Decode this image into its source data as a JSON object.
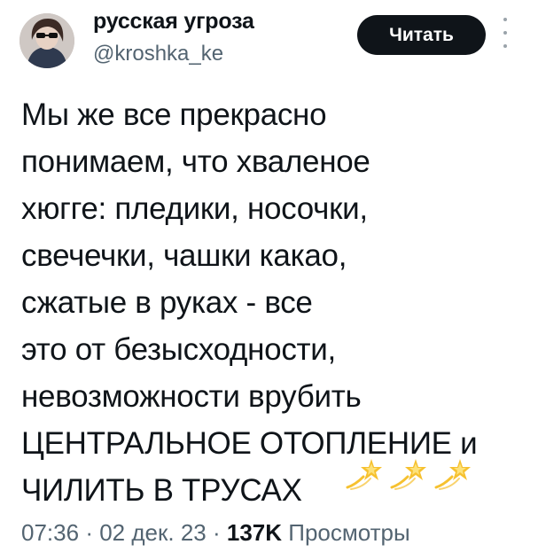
{
  "author": {
    "name": "русская угроза",
    "handle": "@kroshka_ke"
  },
  "header": {
    "read_button_label": "Читать"
  },
  "tweet": {
    "lines": [
      "Мы же все прекрасно",
      "понимаем, что хваленое",
      "хюгге: пледики, носочки,",
      "свечечки, чашки какао,",
      "сжатые в руках - все",
      "это от безысходности,",
      "невозможности врубить",
      "ЦЕНТРАЛЬНОЕ ОТОПЛЕНИЕ и",
      "ЧИЛИТЬ В ТРУСАХ"
    ],
    "emoji_icons": [
      "dizzy-icon",
      "dizzy-icon",
      "dizzy-icon"
    ]
  },
  "meta": {
    "time": "07:36",
    "separator": "·",
    "date": "02 дек. 23",
    "views_count": "137K",
    "views_label": "Просмотры"
  },
  "colors": {
    "text": "#0f1419",
    "secondary": "#536471",
    "button_bg": "#0f1419",
    "emoji_yellow": "#f6c12f"
  }
}
